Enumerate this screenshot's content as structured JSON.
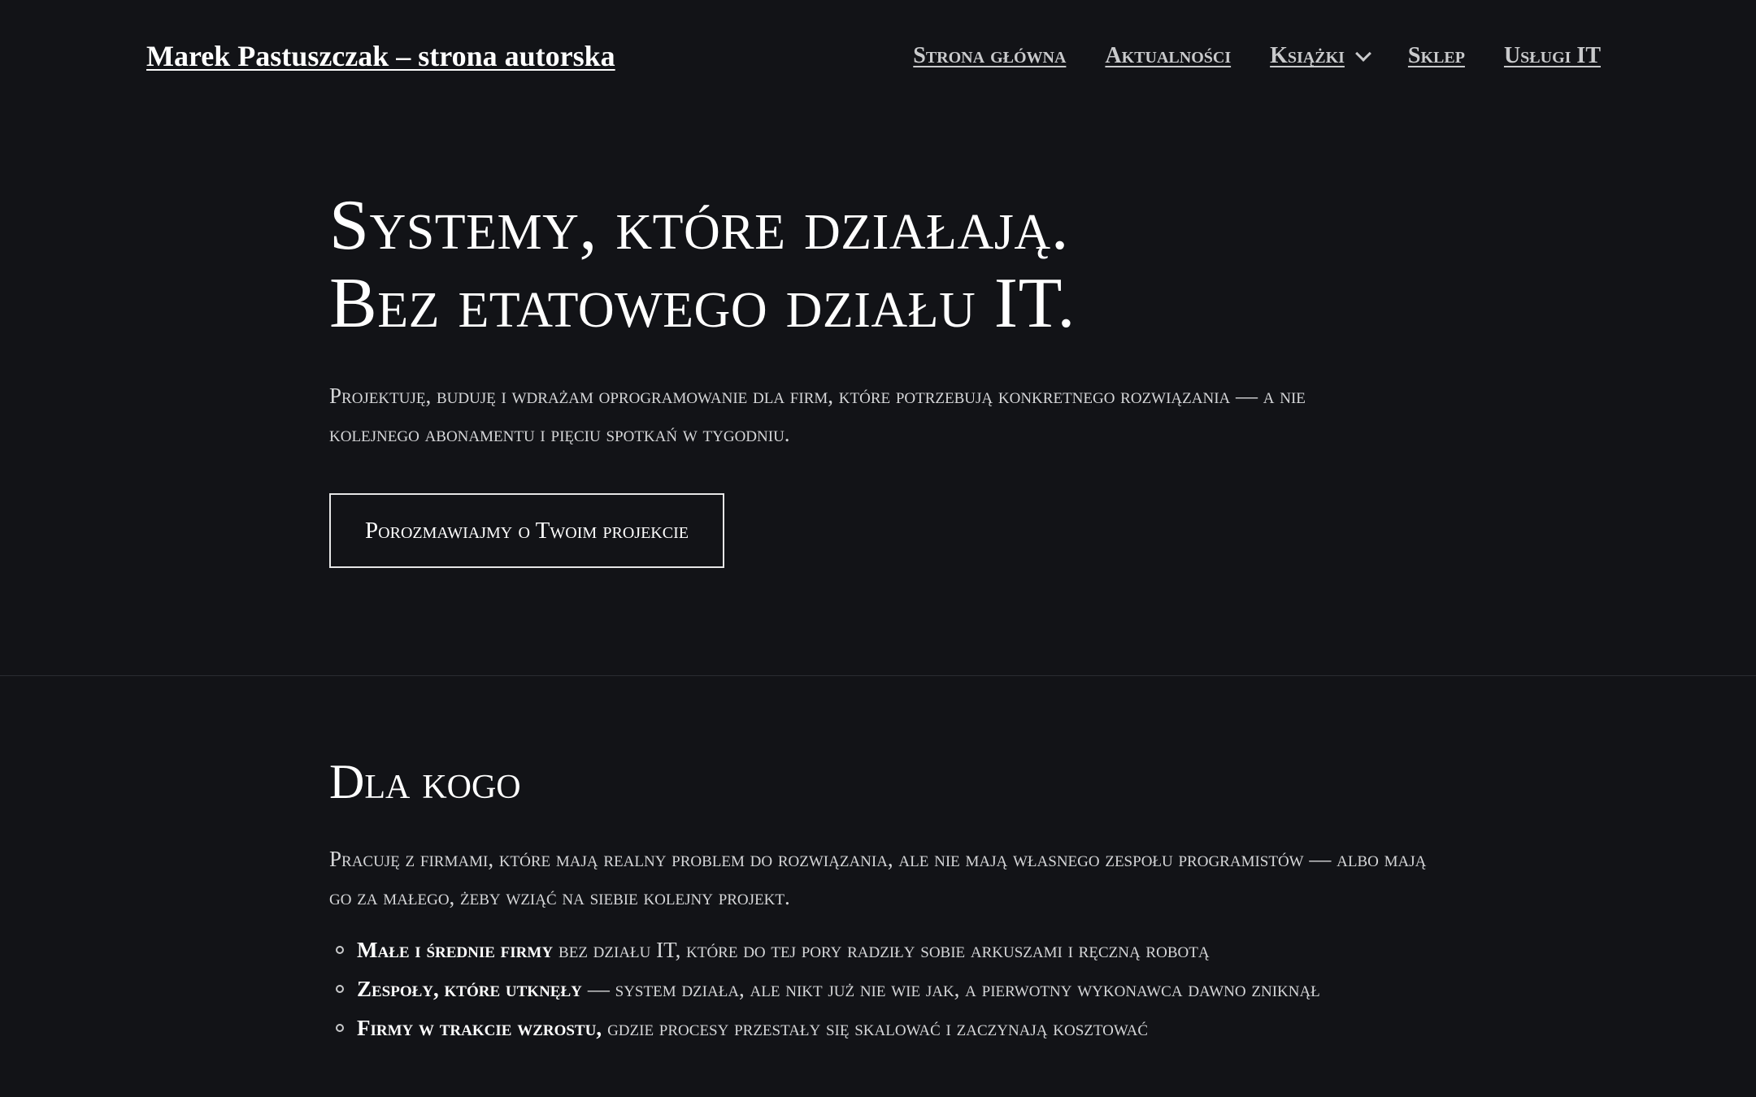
{
  "header": {
    "site_title": "Marek Pastuszczak – strona autorska",
    "nav": [
      {
        "label": "Strona główna"
      },
      {
        "label": "Aktualności"
      },
      {
        "label": "Książki",
        "icon": "chevron-down-icon"
      },
      {
        "label": "Sklep"
      },
      {
        "label": "Usługi IT"
      }
    ]
  },
  "hero": {
    "title_line1": "Systemy, które działają.",
    "title_line2": "Bez etatowego działu IT.",
    "lead": "Projektuję, buduję i wdrażam oprogramowanie dla firm, które potrzebują konkretnego rozwiązania — a nie kolejnego abonamentu i pięciu spotkań w tygodniu.",
    "cta_label": "Porozmawiajmy o Twoim projekcie"
  },
  "audience": {
    "title": "Dla kogo",
    "lead": "Pracuję z firmami, które mają realny problem do rozwiązania, ale nie mają własnego zespołu programistów — albo mają go za małego, żeby wziąć na siebie kolejny projekt.",
    "items": [
      {
        "strong": "Małe i średnie firmy",
        "text": "bez działu IT, które do tej pory radziły sobie arkuszami i ręczną robotą"
      },
      {
        "strong": "Zespoły, które utknęły",
        "text": "— system działa, ale nikt już nie wie jak, a pierwotny wykonawca dawno zniknął"
      },
      {
        "strong": "Firmy w trakcie wzrostu,",
        "text": "gdzie procesy przestały się skalować i zaczynają kosztować"
      }
    ]
  },
  "colors": {
    "background": "#121317",
    "text": "#ffffff",
    "muted_text": "#d6d7d9",
    "divider": "#2a2c31"
  }
}
